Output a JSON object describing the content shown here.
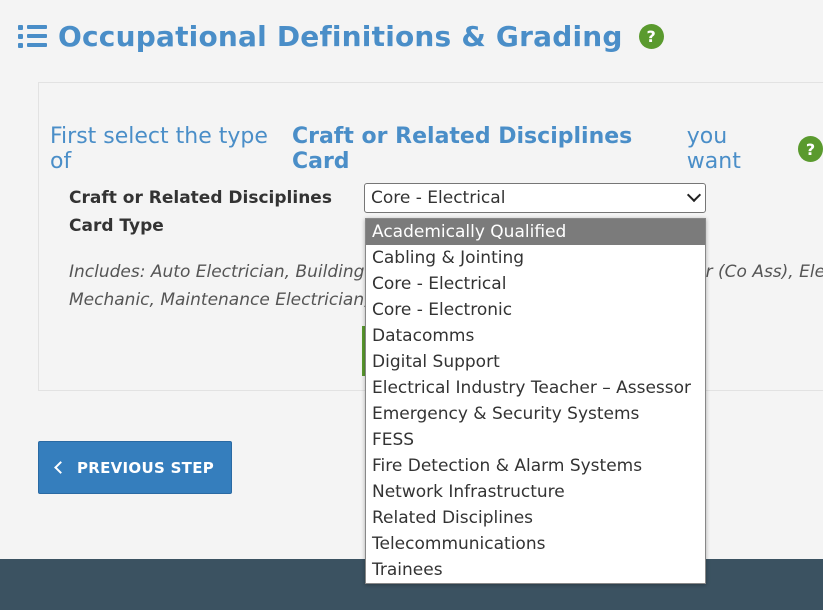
{
  "header": {
    "title": "Occupational Definitions & Grading",
    "help_glyph": "?"
  },
  "prompt": {
    "prefix": "First select the type of",
    "emphasis": "Craft or Related Disciplines Card",
    "suffix": "you want",
    "help_glyph": "?"
  },
  "field": {
    "label_line1": "Craft or Related Disciplines",
    "label_line2": "Card Type",
    "selected_value": "Core - Electrical"
  },
  "includes": {
    "line1": "Includes: Auto Electrician, Building C",
    "line1_right": "eer (Co Ass), Ele",
    "line2": "Mechanic, Maintenance Electrician, M"
  },
  "dropdown": {
    "options": [
      "Academically Qualified",
      "Cabling & Jointing",
      "Core - Electrical",
      "Core - Electronic",
      "Datacomms",
      "Digital Support",
      "Electrical Industry Teacher – Assessor",
      "Emergency & Security Systems",
      "FESS",
      "Fire Detection & Alarm Systems",
      "Network Infrastructure",
      "Related Disciplines",
      "Telecommunications",
      "Trainees"
    ],
    "highlighted": "Academically Qualified"
  },
  "buttons": {
    "previous_step": "PREVIOUS STEP"
  },
  "icons": {
    "list": "list-icon",
    "help": "help-icon",
    "chevron_left": "chevron-left-icon",
    "chevron_down": "chevron-down-icon"
  },
  "colors": {
    "brand_blue": "#4a8ec8",
    "button_blue": "#357ebd",
    "help_green": "#5a9a2e",
    "footer": "#3b5261"
  }
}
